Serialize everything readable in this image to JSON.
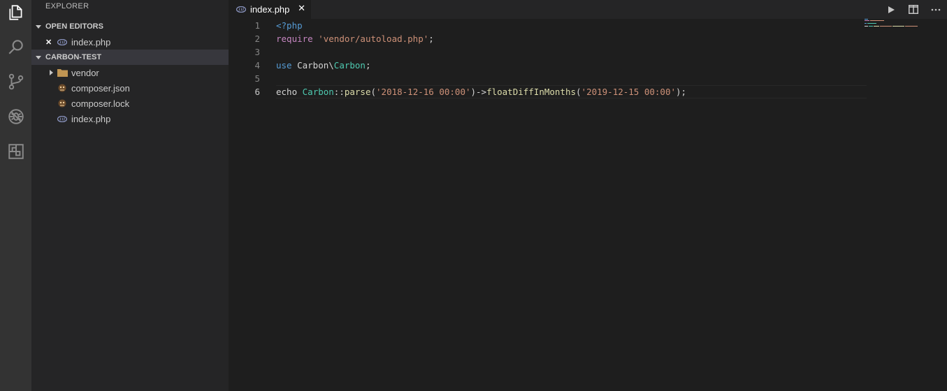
{
  "activity_bar": {
    "items": [
      {
        "name": "explorer-icon"
      },
      {
        "name": "search-icon"
      },
      {
        "name": "source-control-icon"
      },
      {
        "name": "debug-icon"
      },
      {
        "name": "extensions-icon"
      }
    ]
  },
  "sidebar": {
    "title": "EXPLORER",
    "open_editors": {
      "header": "OPEN EDITORS",
      "items": [
        {
          "close": "✕",
          "label": "index.php"
        }
      ]
    },
    "workspace": {
      "header": "CARBON-TEST",
      "items": [
        {
          "label": "vendor",
          "type": "folder"
        },
        {
          "label": "composer.json",
          "type": "composer"
        },
        {
          "label": "composer.lock",
          "type": "composer"
        },
        {
          "label": "index.php",
          "type": "php"
        }
      ]
    }
  },
  "tabs": [
    {
      "label": "index.php",
      "close": "✕"
    }
  ],
  "editor": {
    "line_numbers": [
      "1",
      "2",
      "3",
      "4",
      "5",
      "6"
    ],
    "active_line": 6,
    "lines": {
      "l1": {
        "t1": "<?php"
      },
      "l2": {
        "t1": "require",
        "t2": " ",
        "t3": "'vendor/autoload.php'",
        "t4": ";"
      },
      "l3": {},
      "l4": {
        "t1": "use",
        "t2": " Carbon\\",
        "t3": "Carbon",
        "t4": ";"
      },
      "l5": {},
      "l6": {
        "t1": "echo ",
        "t2": "Carbon",
        "t3": "::",
        "t4": "parse",
        "t5": "(",
        "t6": "'2018-12-16 00:00'",
        "t7": ")->",
        "t8": "floatDiffInMonths",
        "t9": "(",
        "t10": "'2019-12-15 00:00'",
        "t11": ");"
      }
    }
  },
  "colors": {
    "activity_bar": "#333333",
    "sidebar": "#252526",
    "editor": "#1e1e1e",
    "keyword": "#569cd6",
    "control": "#c586c0",
    "string": "#ce9178",
    "class": "#4ec9b0",
    "function": "#dcdcaa"
  }
}
